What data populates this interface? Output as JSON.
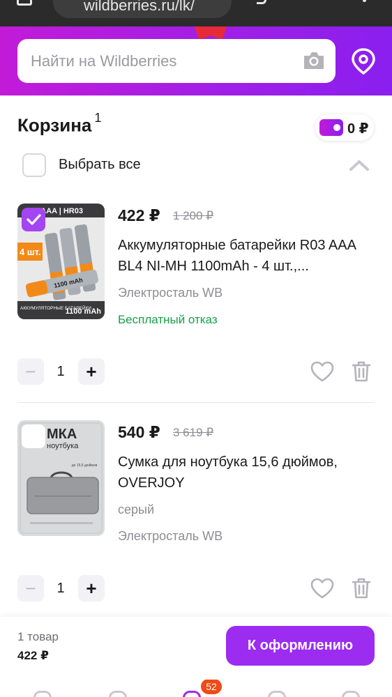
{
  "browser": {
    "url": "wildberries.ru/lk/"
  },
  "search": {
    "placeholder": "Найти на Wildberries",
    "camera_icon": "camera-icon",
    "location_icon": "map-pin-icon"
  },
  "cart": {
    "title": "Корзина",
    "count": "1",
    "wallet_balance": "0 ₽",
    "select_all_label": "Выбрать все",
    "select_all_checked": false
  },
  "items": [
    {
      "price": "422 ₽",
      "old_price": "1 200 ₽",
      "title": "Аккумуляторные батарейки R03 AAA BL4 NI-MH 1100mAh - 4 шт.,...",
      "meta": "Электросталь WB",
      "refund": "Бесплатный отказ",
      "quantity": "1",
      "checked": true,
      "image_text": {
        "top": "AAA | HR03",
        "badge": "4 шт.",
        "cell": "1100 mAh",
        "bottom_left": "АККУМУЛЯТОРНЫЕ БАТАРЕЙКИ",
        "bottom_right": "1100 mAh"
      }
    },
    {
      "price": "540 ₽",
      "old_price": "3 619 ₽",
      "title": "Сумка для ноутбука 15,6 дюймов, OVERJOY",
      "meta": "серый",
      "meta2": "Электросталь WB",
      "quantity": "1",
      "checked": false,
      "image_text": {
        "headline": "МКА",
        "sub": "ноутбука",
        "note": "до 15,6 дюймов"
      }
    }
  ],
  "order": {
    "count_label": "1 товар",
    "total": "422 ₽",
    "checkout_label": "К оформлению"
  },
  "nav": {
    "badge": "52"
  },
  "colors": {
    "brand": "#a11fe6",
    "checkout": "#9b2cf0",
    "checkbox_on": "#a445f2",
    "refund_green": "#14a04a",
    "badge": "#f04a16"
  }
}
